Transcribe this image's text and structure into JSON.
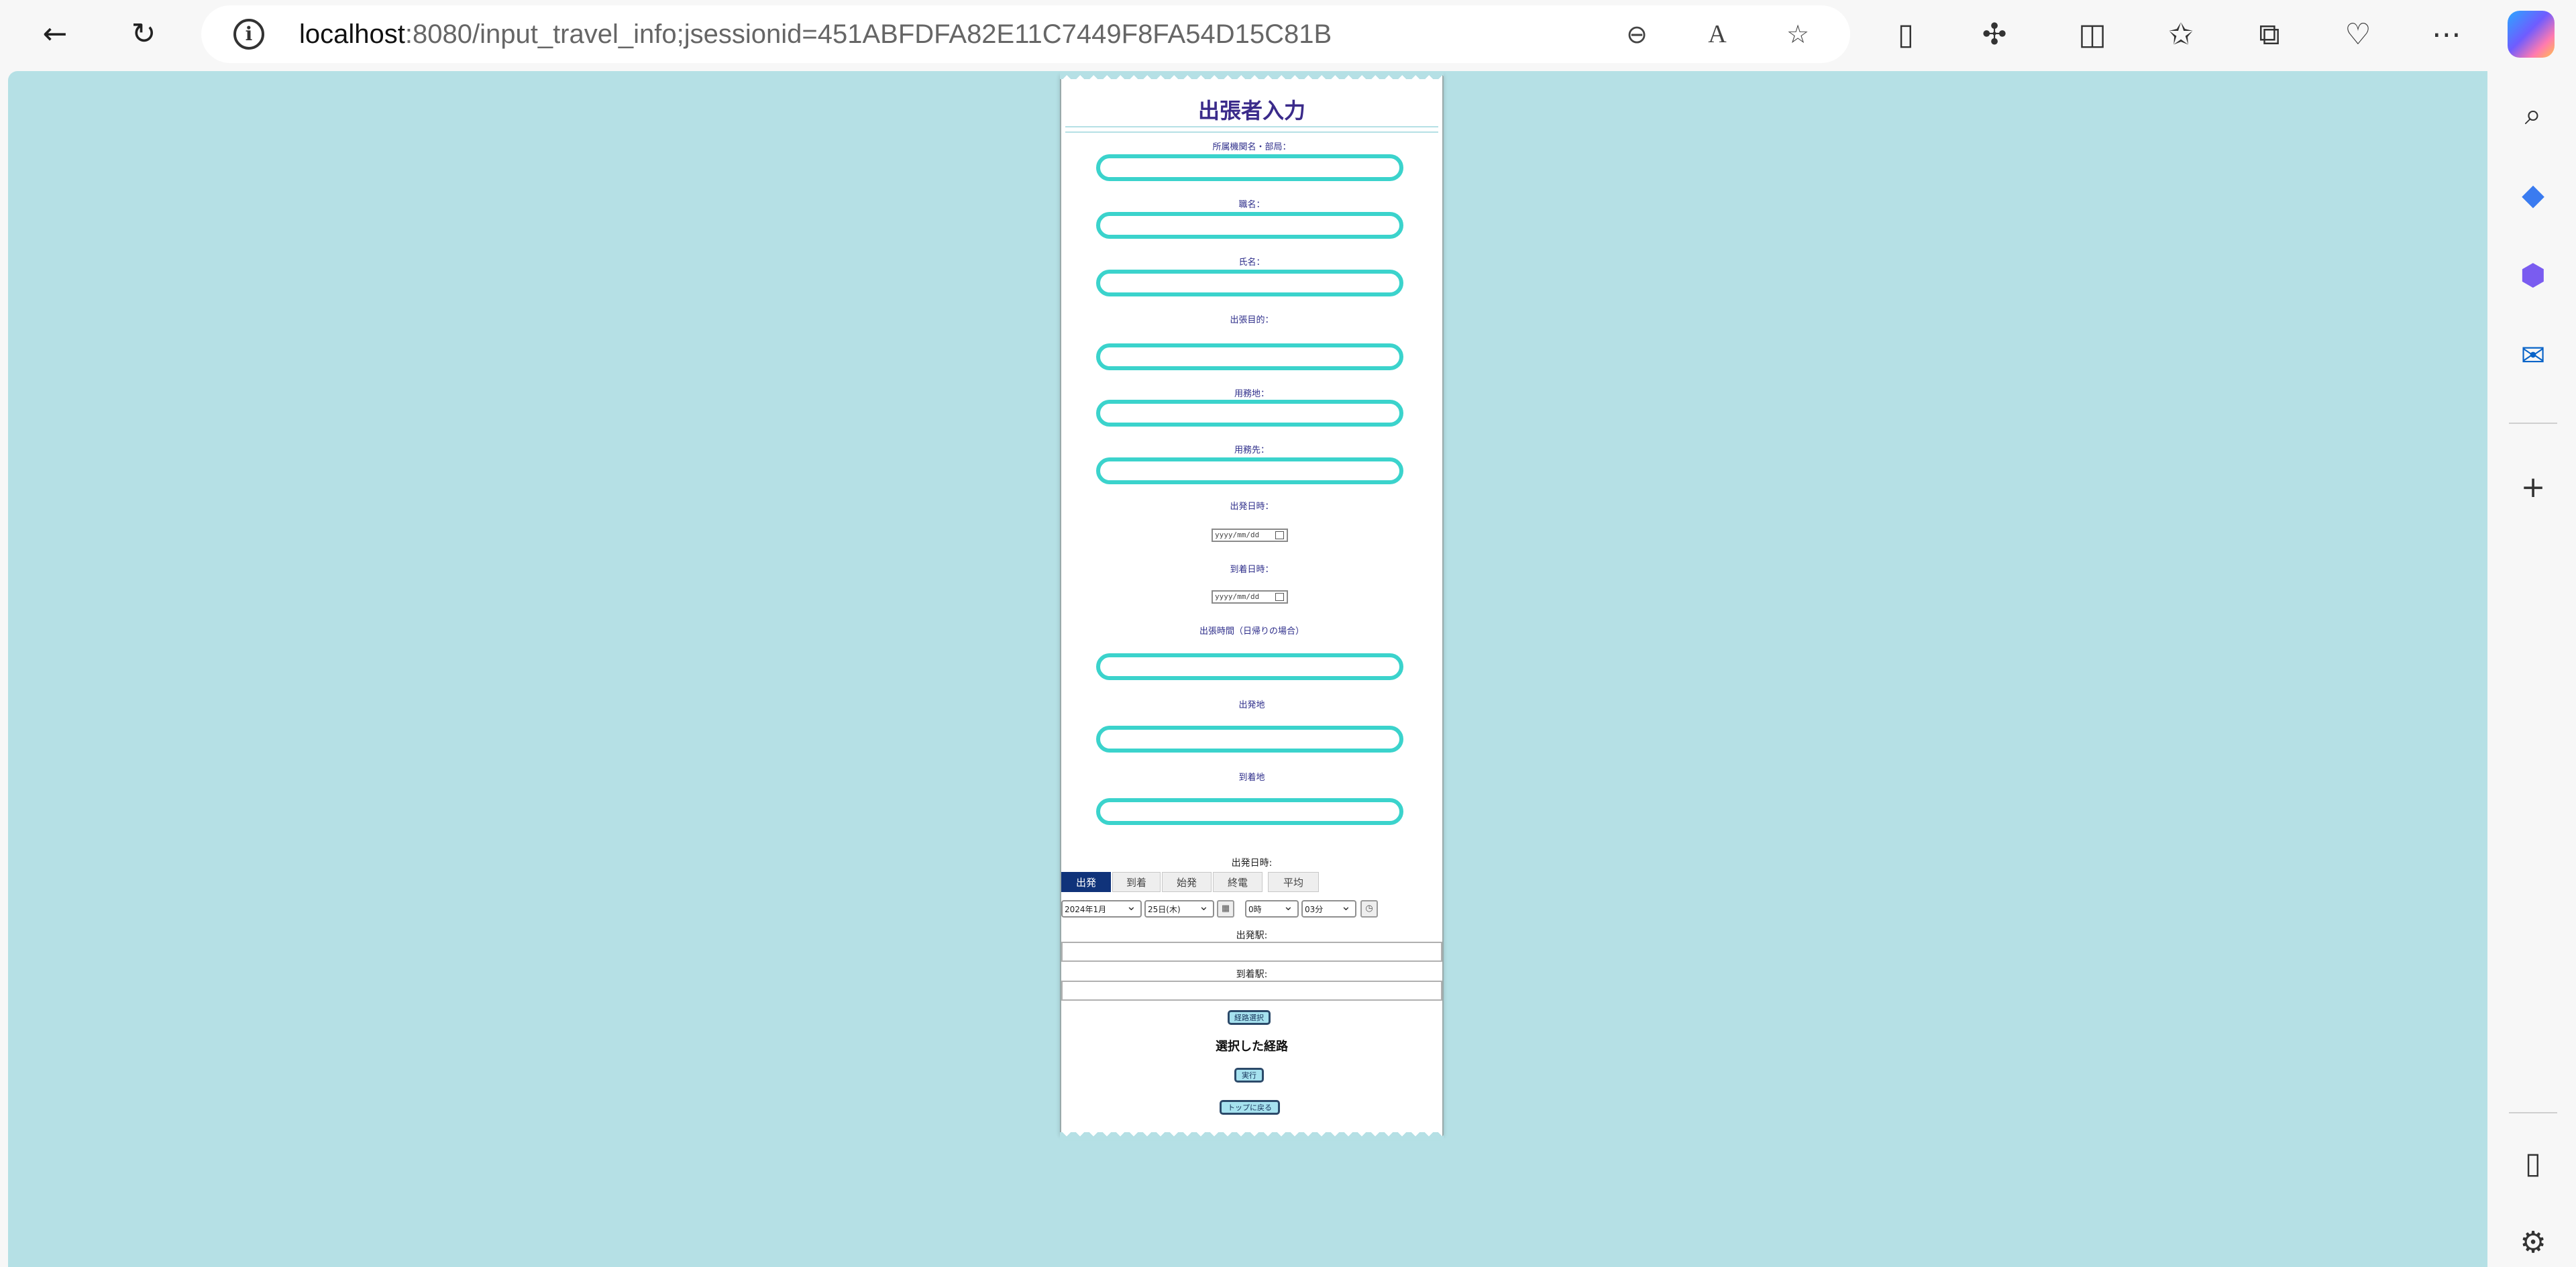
{
  "browser": {
    "url_host": "localhost",
    "url_rest": ":8080/input_travel_info;jsessionid=451ABFDFA82E11C7449F8FA54D15C81B",
    "icons": {
      "back": "back-arrow-icon",
      "reload": "reload-icon",
      "info": "info-icon",
      "zoom": "zoom-out-icon",
      "read_aloud": "read-aloud-icon",
      "favorite": "star-icon"
    }
  },
  "form": {
    "title": "出張者入力",
    "labels": {
      "org": "所属機関名・部局：",
      "position": "職名：",
      "name": "氏名：",
      "purpose": "出張目的：",
      "business_place": "用務地：",
      "business_dest": "用務先：",
      "depart_datetime": "出発日時：",
      "arrive_datetime": "到着日時：",
      "trip_hours": "出張時間（日帰りの場合）",
      "origin": "出発地",
      "destination": "到着地"
    },
    "date_placeholder": "yyyy/mm/dd"
  },
  "route_search": {
    "heading": "出発日時:",
    "tabs": [
      "出発",
      "到着",
      "始発",
      "終電",
      "平均"
    ],
    "active_tab": "出発",
    "year_month": "2024年1月",
    "day": "25日(木)",
    "hour": "0時",
    "minute": "03分",
    "depart_station_label": "出発駅:",
    "arrive_station_label": "到着駅:",
    "route_select_button": "経路選択",
    "selected_route_title": "選択した経路",
    "execute_button": "実行",
    "back_top_button": "トップに戻る"
  },
  "colors": {
    "page_bg": "#b5e0e5",
    "input_border": "#3bd3cc",
    "title": "#3a2a8a",
    "active_tab": "#10337a"
  }
}
